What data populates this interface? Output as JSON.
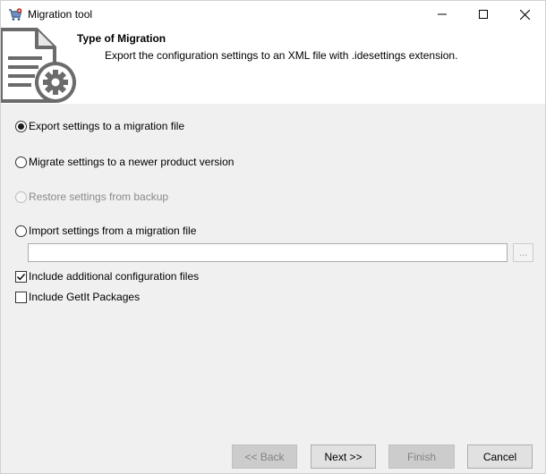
{
  "window": {
    "title": "Migration tool",
    "icon": "migration-tool-icon"
  },
  "header": {
    "title": "Type of Migration",
    "description": "Export the configuration settings to an XML file with .idesettings extension.",
    "icon": "document-gear-icon"
  },
  "options": {
    "export": {
      "label": "Export settings to a migration file",
      "checked": true
    },
    "migrate": {
      "label": "Migrate settings to a newer product version",
      "checked": false
    },
    "restore": {
      "label": "Restore settings from backup",
      "checked": false,
      "disabled": true
    },
    "import": {
      "label": "Import settings from a migration file",
      "checked": false
    },
    "import_path": {
      "value": ""
    },
    "browse_label": "...",
    "include_config": {
      "label": "Include additional configuration files",
      "checked": true
    },
    "include_getit": {
      "label": "Include GetIt Packages",
      "checked": false
    }
  },
  "buttons": {
    "back": "<< Back",
    "next": "Next >>",
    "finish": "Finish",
    "cancel": "Cancel"
  }
}
